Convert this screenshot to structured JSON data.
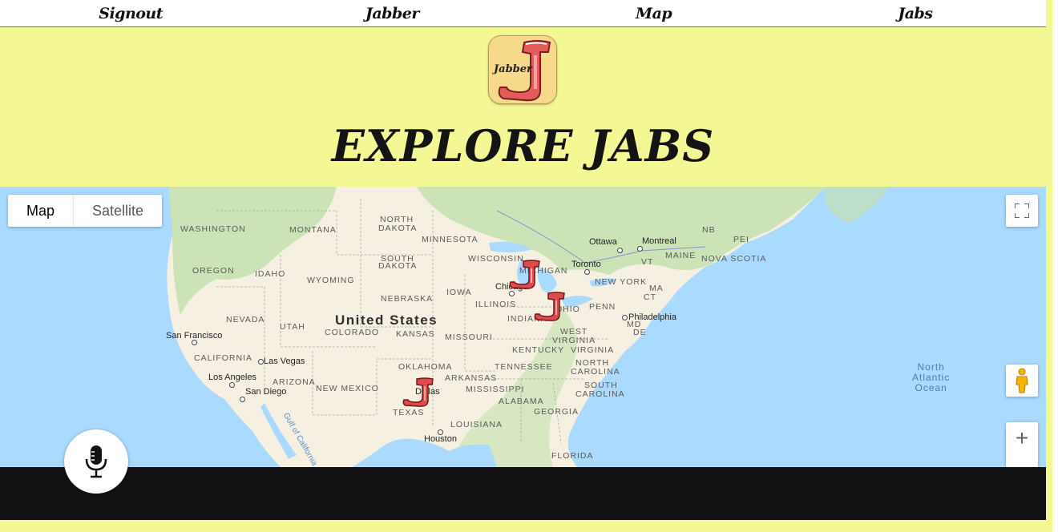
{
  "nav": {
    "items": [
      {
        "label": "Signout"
      },
      {
        "label": "Jabber"
      },
      {
        "label": "Map"
      },
      {
        "label": "Jabs"
      }
    ]
  },
  "header": {
    "logo_text": "Jabber",
    "title": "EXPLORE JABS"
  },
  "map": {
    "type_control": {
      "map_label": "Map",
      "satellite_label": "Satellite",
      "selected": "Map"
    },
    "country_label": "United States",
    "ocean_label_lines": [
      "North",
      "Atlantic",
      "Ocean"
    ],
    "region_labels": [
      "WASHINGTON",
      "MONTANA",
      "NORTH",
      "DAKOTA",
      "MINNESOTA",
      "OREGON",
      "IDAHO",
      "SOUTH",
      "DAKOTA",
      "WYOMING",
      "WISCONSIN",
      "MICHIGAN",
      "NB",
      "PEI",
      "MAINE",
      "NOVA SCOTIA",
      "VT",
      "NEW YORK",
      "MA",
      "CT",
      "IOWA",
      "NEBRASKA",
      "ILLINOIS",
      "INDIANA",
      "OHIO",
      "PENN",
      "NEVADA",
      "UTAH",
      "COLORADO",
      "KANSAS",
      "MISSOURI",
      "MD",
      "DE",
      "WEST",
      "VIRGINIA",
      "VIRGINIA",
      "KENTUCKY",
      "CALIFORNIA",
      "OKLAHOMA",
      "TENNESSEE",
      "NORTH",
      "CAROLINA",
      "ARIZONA",
      "NEW MEXICO",
      "ARKANSAS",
      "SOUTH",
      "CAROLINA",
      "MISSISSIPPI",
      "ALABAMA",
      "GEORGIA",
      "TEXAS",
      "LOUISIANA",
      "FLORIDA",
      "Gulf of California"
    ],
    "cities": [
      "Ottawa",
      "Montreal",
      "Toronto",
      "Chicago",
      "Philadelphia",
      "San Francisco",
      "Las Vegas",
      "Los Angeles",
      "San Diego",
      "Dallas",
      "Houston"
    ],
    "marker_count": 3,
    "zoom_in_symbol": "+"
  },
  "colors": {
    "page_background": "#f3f895",
    "water": "#aadaff",
    "land": "#f5f0e1",
    "forest": "#c4e0b0",
    "footer": "#121214",
    "marker_red": "#e04a4a"
  },
  "icons": {
    "fullscreen": "fullscreen-icon",
    "pegman": "pegman-icon",
    "microphone": "microphone-icon",
    "jab_marker": "jab-marker-icon"
  }
}
